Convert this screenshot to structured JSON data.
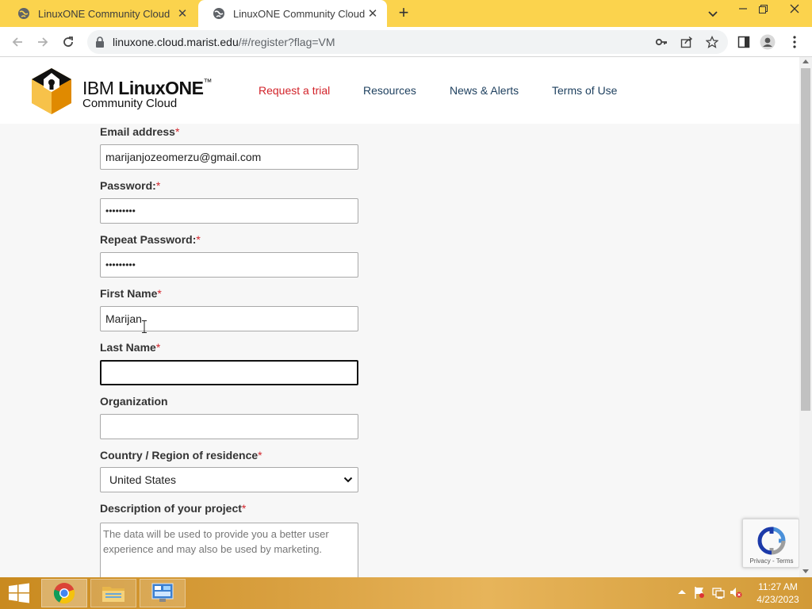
{
  "browser": {
    "tabs": [
      {
        "title": "LinuxONE Community Cloud",
        "active": false
      },
      {
        "title": "LinuxONE Community Cloud",
        "active": true
      }
    ],
    "url_host": "linuxone.cloud.marist.edu",
    "url_path": "/#/register?flag=VM",
    "icons": [
      "tab-search-icon",
      "minimize-icon",
      "maximize-icon",
      "close-icon",
      "back-icon",
      "forward-icon",
      "reload-icon",
      "lock-icon",
      "key-icon",
      "share-icon",
      "bookmark-star-icon",
      "side-panel-icon",
      "profile-icon",
      "menu-kebab-icon"
    ]
  },
  "site": {
    "logo": {
      "ibm": "IBM ",
      "linuxone": "LinuxONE",
      "tm": "™",
      "subtitle": "Community Cloud"
    },
    "nav": [
      {
        "label": "Request a trial",
        "active": true
      },
      {
        "label": "Resources",
        "active": false
      },
      {
        "label": "News & Alerts",
        "active": false
      },
      {
        "label": "Terms of Use",
        "active": false
      }
    ],
    "active_color": "#d2232a",
    "nav_color": "#1d3f5e"
  },
  "form": {
    "required_marker": "*",
    "email": {
      "label": "Email address",
      "value": "marijanjozeomerzu@gmail.com"
    },
    "password": {
      "label": "Password:",
      "value": "•••••••••"
    },
    "repeat_password": {
      "label": "Repeat Password:",
      "value": "•••••••••"
    },
    "first_name": {
      "label": "First Name",
      "value": "Marijan"
    },
    "last_name": {
      "label": "Last Name",
      "value": ""
    },
    "organization": {
      "label": "Organization",
      "value": ""
    },
    "country": {
      "label": "Country / Region of residence",
      "selected": "United States"
    },
    "description": {
      "label": "Description of your project",
      "placeholder": "The data will be used to provide you a better user experience and may also be used by marketing."
    }
  },
  "recaptcha": {
    "links": "Privacy - Terms"
  },
  "taskbar": {
    "apps": [
      "chrome",
      "file-explorer",
      "control-panel"
    ],
    "time": "11:27 AM",
    "date": "4/23/2023"
  }
}
